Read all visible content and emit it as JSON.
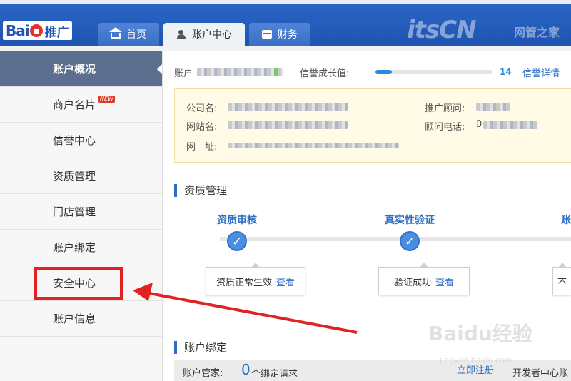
{
  "header": {
    "logo_text": "Bai",
    "logo_suffix": "推广",
    "tabs": [
      {
        "label": "首页",
        "icon": "home-icon"
      },
      {
        "label": "账户中心",
        "icon": "user-icon"
      },
      {
        "label": "财务",
        "icon": "money-icon"
      }
    ],
    "watermark": "itsCN",
    "watermark_cn": "网管之家"
  },
  "sidebar": {
    "items": [
      {
        "label": "账户概况"
      },
      {
        "label": "商户名片",
        "badge": "NEW"
      },
      {
        "label": "信誉中心"
      },
      {
        "label": "资质管理"
      },
      {
        "label": "门店管理"
      },
      {
        "label": "账户绑定"
      },
      {
        "label": "安全中心"
      },
      {
        "label": "账户信息"
      }
    ]
  },
  "account": {
    "label": "账户",
    "credit_label": "信誉成长值:",
    "credit_value": "14",
    "credit_fraction": 0.14,
    "credit_link": "信誉详情",
    "cut_text": "安"
  },
  "info": {
    "company_label": "公司名:",
    "site_label": "网站名:",
    "url_label": "网　址:",
    "advisor_label": "推广顾问:",
    "phone_label": "顾问电话:",
    "phone_partial": "0"
  },
  "qualification": {
    "title": "资质管理",
    "steps": [
      {
        "title": "资质审核",
        "status": "资质正常生效",
        "link": "查看"
      },
      {
        "title": "真实性验证",
        "status": "验证成功",
        "link": "查看"
      },
      {
        "title": "账",
        "status": "不"
      }
    ],
    "check_mark": "✓"
  },
  "binding": {
    "title": "账户绑定",
    "manager_label": "账户管家:",
    "count": "0",
    "count_suffix": "个绑定请求",
    "register_link": "立即注册",
    "developer_text": "开发者中心账"
  },
  "footer_watermark": "Baidu经验",
  "footer_watermark_url": "jingyan.baidu.com",
  "colors": {
    "header_blue": "#1f54b0",
    "active_sidebar": "#5c6f8f",
    "link_blue": "#2e6fc6",
    "highlight_red": "#e02222"
  }
}
